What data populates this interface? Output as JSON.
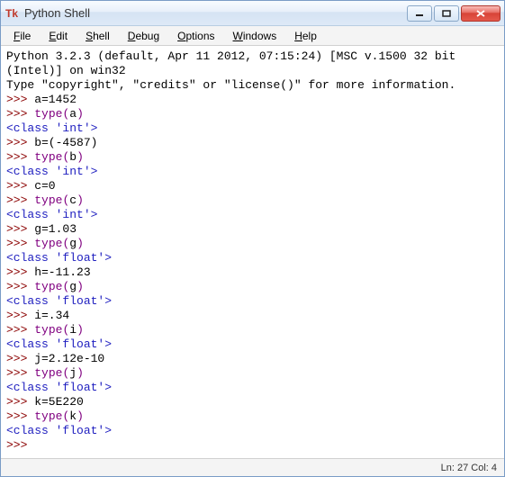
{
  "window": {
    "title": "Python Shell",
    "icon_label": "Tk"
  },
  "menu": {
    "items": [
      {
        "label": "File",
        "accel": "F"
      },
      {
        "label": "Edit",
        "accel": "E"
      },
      {
        "label": "Shell",
        "accel": "S"
      },
      {
        "label": "Debug",
        "accel": "D"
      },
      {
        "label": "Options",
        "accel": "O"
      },
      {
        "label": "Windows",
        "accel": "W"
      },
      {
        "label": "Help",
        "accel": "H"
      }
    ]
  },
  "console": {
    "banner1": "Python 3.2.3 (default, Apr 11 2012, 07:15:24) [MSC v.1500 32 bit (Intel)] on win32",
    "banner2": "Type \"copyright\", \"credits\" or \"license()\" for more information.",
    "prompt": ">>>",
    "lines": {
      "l1_input": " a=1452",
      "l2_kw": "type",
      "l2_arg": "a",
      "l2_out": "<class 'int'>",
      "l3_input": " b=(-4587)",
      "l4_kw": "type",
      "l4_arg": "b",
      "l4_out": "<class 'int'>",
      "l5_input": " c=0",
      "l6_kw": "type",
      "l6_arg": "c",
      "l6_out": "<class 'int'>",
      "l7_input": " g=1.03",
      "l8_kw": "type",
      "l8_arg": "g",
      "l8_out": "<class 'float'>",
      "l9_input": " h=-11.23",
      "l10_kw": "type",
      "l10_arg": "g",
      "l10_out": "<class 'float'>",
      "l11_input": " i=.34",
      "l12_kw": "type",
      "l12_arg": "i",
      "l12_out": "<class 'float'>",
      "l13_input": " j=2.12e-10",
      "l14_kw": "type",
      "l14_arg": "j",
      "l14_out": "<class 'float'>",
      "l15_input": " k=5E220",
      "l16_kw": "type",
      "l16_arg": "k",
      "l16_out": "<class 'float'>",
      "final_prompt_tail": " "
    }
  },
  "status": {
    "text": "Ln: 27 Col: 4",
    "line": 27,
    "col": 4
  }
}
